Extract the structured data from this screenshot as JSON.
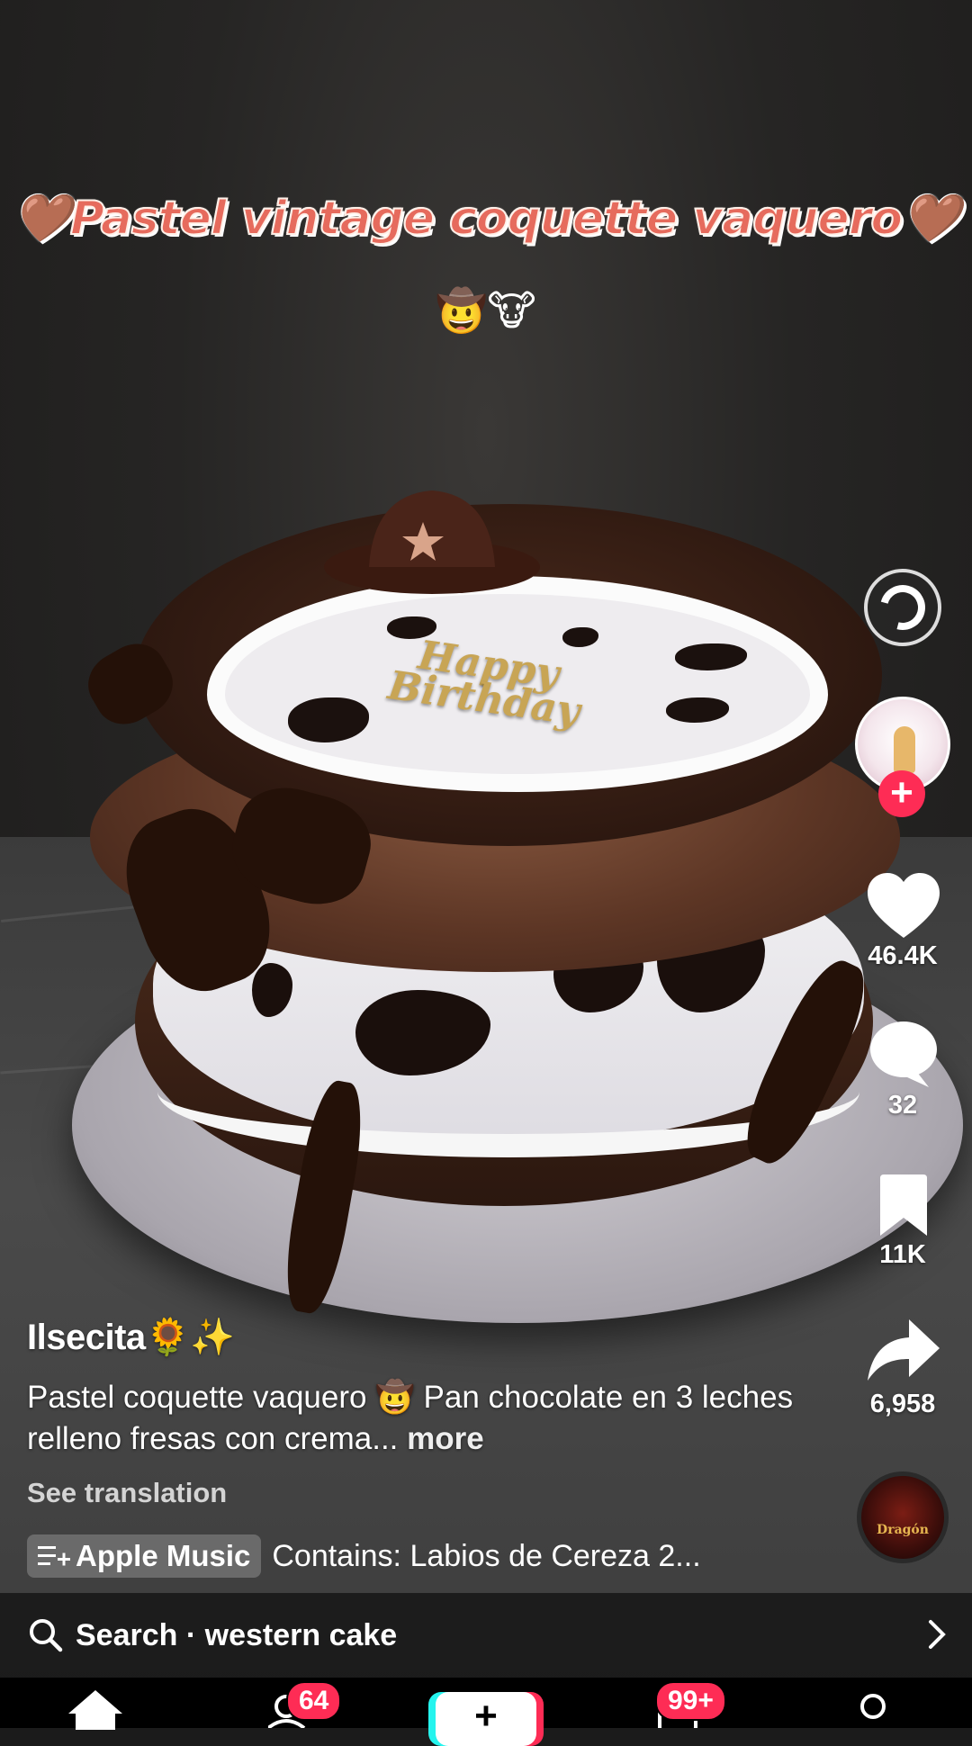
{
  "video": {
    "headline": "🤎Pastel vintage coquette vaquero🤎",
    "headline_emojis": "🤠🐮",
    "cake_plaque": "Happy Birthday"
  },
  "actions": {
    "likes": "46.4K",
    "comments": "32",
    "saves": "11K",
    "shares": "6,958"
  },
  "caption": {
    "username": "Ilsecita🌻✨",
    "text": "Pastel coquette vaquero 🤠 Pan chocolate en 3 leches relleno fresas con crema...",
    "more": "more",
    "see_translation": "See translation"
  },
  "music": {
    "chip_label": "Apple Music",
    "track": "Contains: Labios de Cereza 2...",
    "disc_label": "Dragón"
  },
  "search": {
    "text": "Search · western cake"
  },
  "tabs": {
    "friends_badge": "64",
    "inbox_badge": "99+",
    "create": "+"
  },
  "colors": {
    "accent_red": "#fe2c55",
    "accent_cyan": "#25f4ee"
  }
}
